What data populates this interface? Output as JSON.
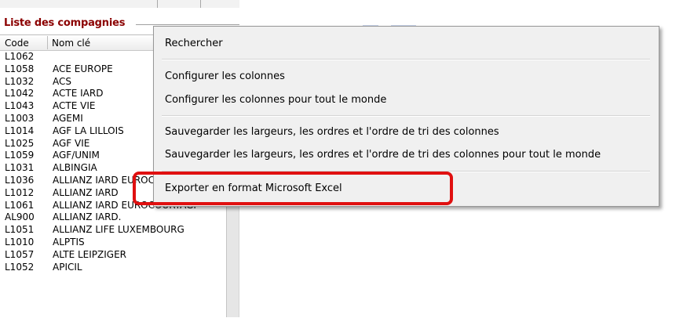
{
  "panel": {
    "title": "Liste des compagnies",
    "columns": {
      "code": "Code",
      "name": "Nom clé"
    }
  },
  "rows": [
    {
      "code": "L1062",
      "name": ""
    },
    {
      "code": "L1058",
      "name": "ACE EUROPE"
    },
    {
      "code": "L1032",
      "name": "ACS"
    },
    {
      "code": "L1042",
      "name": "ACTE IARD"
    },
    {
      "code": "L1043",
      "name": "ACTE VIE"
    },
    {
      "code": "L1003",
      "name": "AGEMI"
    },
    {
      "code": "L1014",
      "name": "AGF LA LILLOIS"
    },
    {
      "code": "L1025",
      "name": "AGF VIE"
    },
    {
      "code": "L1059",
      "name": "AGF/UNIM"
    },
    {
      "code": "L1031",
      "name": "ALBINGIA"
    },
    {
      "code": "L1036",
      "name": "ALLIANZ  IARD EUROCOURT…"
    },
    {
      "code": "L1012",
      "name": "ALLIANZ IARD"
    },
    {
      "code": "L1061",
      "name": "ALLIANZ IARD EUROCOURTAGI"
    },
    {
      "code": "AL900",
      "name": "ALLIANZ IARD."
    },
    {
      "code": "L1051",
      "name": "ALLIANZ LIFE LUXEMBOURG"
    },
    {
      "code": "L1010",
      "name": "ALPTIS"
    },
    {
      "code": "L1057",
      "name": "ALTE LEIPZIGER"
    },
    {
      "code": "L1052",
      "name": "APICIL"
    }
  ],
  "menu": {
    "search": "Rechercher",
    "configure_columns": "Configurer les colonnes",
    "configure_columns_all": "Configurer les colonnes pour tout le monde",
    "save_widths": "Sauvegarder les largeurs, les ordres et l'ordre de tri des colonnes",
    "save_widths_all": "Sauvegarder les largeurs, les ordres et l'ordre de tri des colonnes pour tout le monde",
    "export_excel": "Exporter en format Microsoft Excel"
  },
  "colors": {
    "title": "#8b0000",
    "highlight": "#e01010"
  }
}
